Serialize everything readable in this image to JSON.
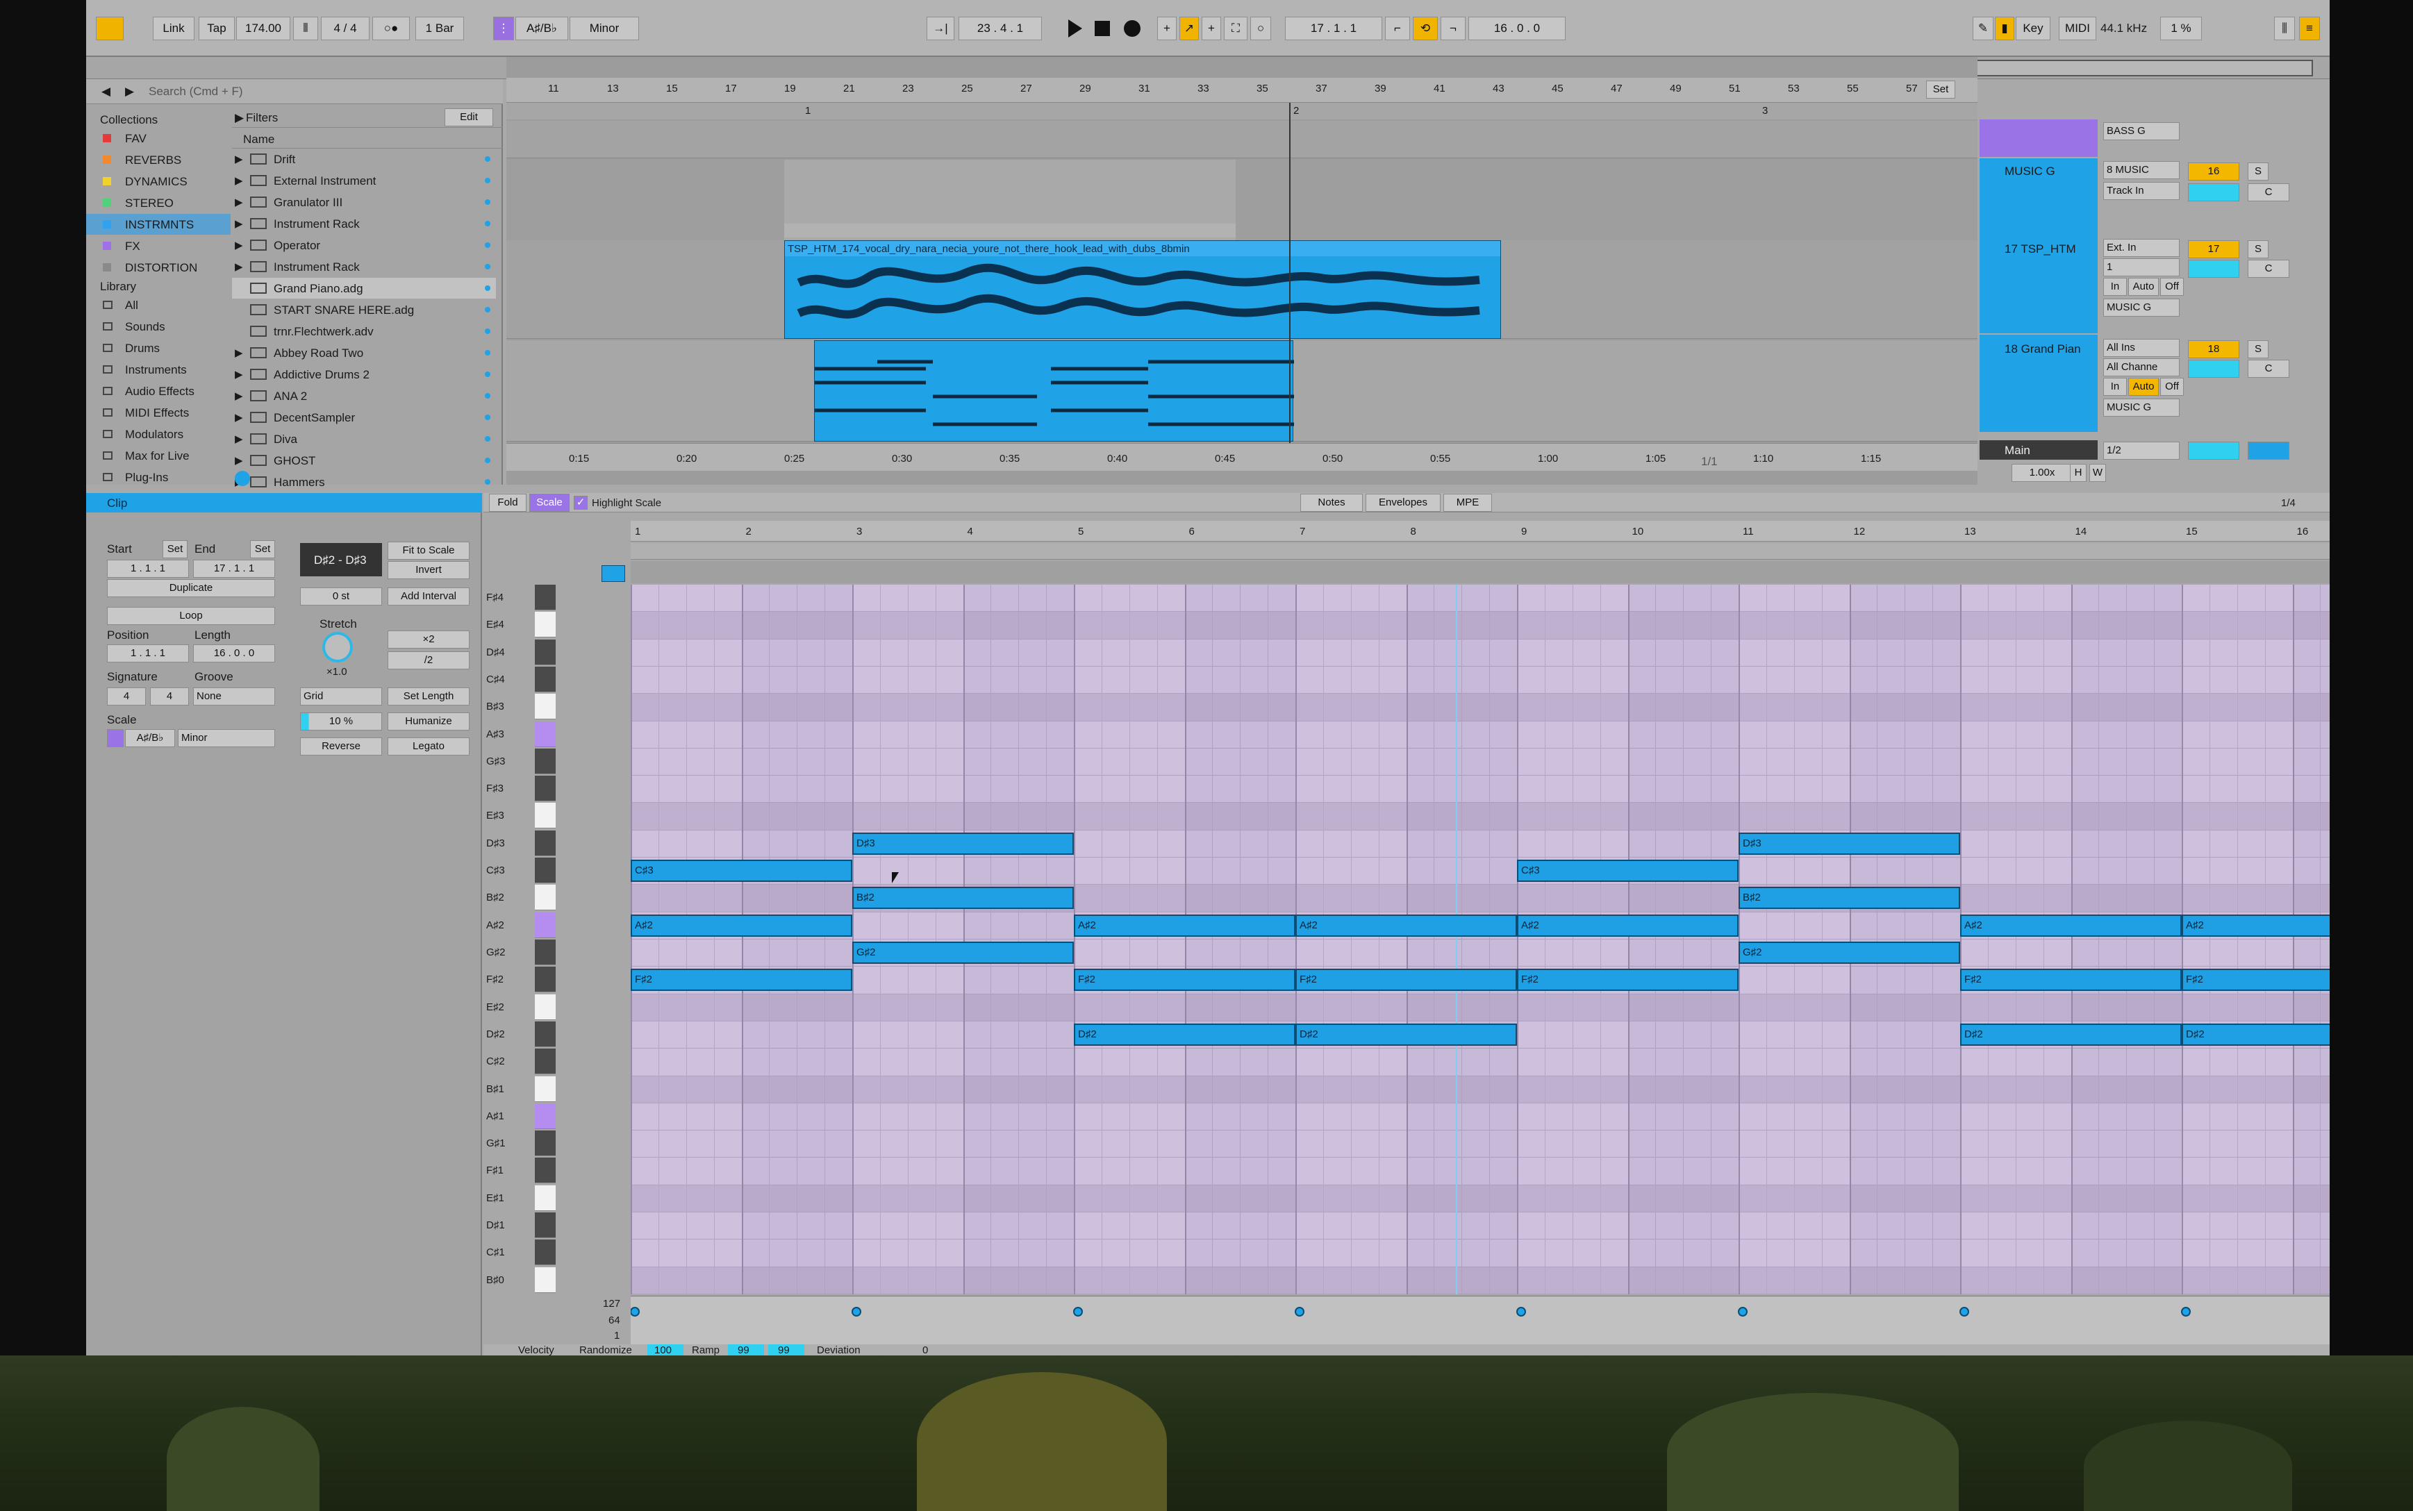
{
  "topbar": {
    "link": "Link",
    "tap": "Tap",
    "tempo": "174.00",
    "signature": "4 / 4",
    "quantize": "1 Bar",
    "scale_key": "A♯/B♭",
    "scale_mode": "Minor",
    "position": "23 . 4 . 1",
    "loop_start": "17 . 1 . 1",
    "loop_length": "16 . 0 . 0",
    "key_label": "Key",
    "midi_label": "MIDI",
    "sample_rate": "44.1 kHz",
    "cpu": "1 %"
  },
  "browser": {
    "search_placeholder": "Search (Cmd + F)",
    "collections_title": "Collections",
    "collections": [
      {
        "label": "FAV",
        "color": "#e23b3b"
      },
      {
        "label": "REVERBS",
        "color": "#f08a2c"
      },
      {
        "label": "DYNAMICS",
        "color": "#f2d12e"
      },
      {
        "label": "STEREO",
        "color": "#4fd27a"
      },
      {
        "label": "INSTRMNTS",
        "color": "#2fa3f0"
      },
      {
        "label": "FX",
        "color": "#a070e8"
      },
      {
        "label": "DISTORTION",
        "color": "#8a8a8a"
      }
    ],
    "library_title": "Library",
    "library": [
      "All",
      "Sounds",
      "Drums",
      "Instruments",
      "Audio Effects",
      "MIDI Effects",
      "Modulators",
      "Max for Live",
      "Plug-Ins"
    ],
    "filters_label": "Filters",
    "edit_label": "Edit",
    "name_header": "Name",
    "items": [
      "Drift",
      "External Instrument",
      "Granulator III",
      "Instrument Rack",
      "Operator",
      "Instrument Rack",
      "Grand Piano.adg",
      "START SNARE HERE.adg",
      "trnr.Flechtwerk.adv",
      "Abbey Road Two",
      "Addictive Drums 2",
      "ANA 2",
      "DecentSampler",
      "Diva",
      "GHOST",
      "Hammers"
    ]
  },
  "arrangement": {
    "bar_numbers": [
      "11",
      "13",
      "15",
      "17",
      "19",
      "21",
      "23",
      "25",
      "27",
      "29",
      "31",
      "33",
      "35",
      "37",
      "39",
      "41",
      "43",
      "45",
      "47",
      "49",
      "51",
      "53",
      "55",
      "57"
    ],
    "locators": [
      "1",
      "2",
      "3"
    ],
    "time_labels": [
      "0:15",
      "0:20",
      "0:25",
      "0:30",
      "0:35",
      "0:40",
      "0:45",
      "0:50",
      "0:55",
      "1:00",
      "1:05",
      "1:10",
      "1:15"
    ],
    "audio_clip_name": "TSP_HTM_174_vocal_dry_nara_necia_youre_not_there_hook_lead_with_dubs_8bmin",
    "page_counter": "1/1",
    "set_label": "Set"
  },
  "mixer": {
    "tracks": [
      {
        "name": "MUSIC G",
        "input": "8 MUSIC",
        "routing": "Track In",
        "number": "16",
        "color": "#1fa2e6"
      },
      {
        "name": "17 TSP_HTM",
        "input": "Ext. In",
        "routing": "1",
        "output": "MUSIC G",
        "number": "17",
        "color": "#1fa2e6"
      },
      {
        "name": "18 Grand Pian",
        "input": "All Ins",
        "routing": "All Channe",
        "output": "MUSIC G",
        "number": "18",
        "color": "#1fa2e6"
      }
    ],
    "bass_group": "BASS G",
    "main_label": "Main",
    "main_routing": "1/2",
    "zoom": "1.00x",
    "s_label": "S",
    "c_label": "C",
    "in_label": "In",
    "auto_label": "Auto",
    "off_label": "Off",
    "h_label": "H",
    "w_label": "W"
  },
  "clip": {
    "title": "Clip",
    "start_label": "Start",
    "end_label": "End",
    "set_label": "Set",
    "start_value": "1 . 1 . 1",
    "end_value": "17 . 1 . 1",
    "duplicate": "Duplicate",
    "loop": "Loop",
    "position_label": "Position",
    "length_label": "Length",
    "position_value": "1 . 1 . 1",
    "length_value": "16 . 0 . 0",
    "signature_label": "Signature",
    "groove_label": "Groove",
    "sig_num": "4",
    "sig_den": "4",
    "groove_value": "None",
    "scale_label": "Scale",
    "scale_key": "A♯/B♭",
    "scale_mode": "Minor",
    "range": "D♯2 - D♯3",
    "fit_to_scale": "Fit to Scale",
    "invert": "Invert",
    "semitones": "0 st",
    "add_interval": "Add Interval",
    "stretch_label": "Stretch",
    "stretch_value": "×1.0",
    "double": "×2",
    "half": "/2",
    "grid": "Grid",
    "set_length": "Set Length",
    "humanize_amount": "10 %",
    "humanize": "Humanize",
    "reverse": "Reverse",
    "legato": "Legato"
  },
  "pianoroll": {
    "fold": "Fold",
    "scale": "Scale",
    "highlight_scale": "Highlight Scale",
    "tabs": [
      "Notes",
      "Envelopes",
      "MPE"
    ],
    "grid_setting": "1/4",
    "bar_numbers": [
      "1",
      "2",
      "3",
      "4",
      "5",
      "6",
      "7",
      "8",
      "9",
      "10",
      "11",
      "12",
      "13",
      "14",
      "15",
      "16"
    ],
    "keys": [
      "F♯4",
      "E♯4",
      "D♯4",
      "C♯4",
      "B♯3",
      "A♯3",
      "G♯3",
      "F♯3",
      "E♯3",
      "D♯3",
      "C♯3",
      "B♯2",
      "A♯2",
      "G♯2",
      "F♯2",
      "E♯2",
      "D♯2",
      "C♯2",
      "B♯1",
      "A♯1",
      "G♯1",
      "F♯1",
      "E♯1",
      "D♯1",
      "C♯1",
      "B♯0"
    ],
    "notes": [
      {
        "pitch": "C♯3",
        "start": 1,
        "length": 2,
        "label": "C♯3"
      },
      {
        "pitch": "A♯2",
        "start": 1,
        "length": 2,
        "label": "A♯2"
      },
      {
        "pitch": "F♯2",
        "start": 1,
        "length": 2,
        "label": "F♯2"
      },
      {
        "pitch": "D♯3",
        "start": 3,
        "length": 2,
        "label": "D♯3"
      },
      {
        "pitch": "B♯2",
        "start": 3,
        "length": 2,
        "label": "B♯2"
      },
      {
        "pitch": "G♯2",
        "start": 3,
        "length": 2,
        "label": "G♯2"
      },
      {
        "pitch": "A♯2",
        "start": 5,
        "length": 2,
        "label": "A♯2"
      },
      {
        "pitch": "F♯2",
        "start": 5,
        "length": 2,
        "label": "F♯2"
      },
      {
        "pitch": "D♯2",
        "start": 5,
        "length": 2,
        "label": "D♯2"
      },
      {
        "pitch": "A♯2",
        "start": 7,
        "length": 2,
        "label": "A♯2"
      },
      {
        "pitch": "F♯2",
        "start": 7,
        "length": 2,
        "label": "F♯2"
      },
      {
        "pitch": "D♯2",
        "start": 7,
        "length": 2,
        "label": "D♯2"
      },
      {
        "pitch": "C♯3",
        "start": 9,
        "length": 2,
        "label": "C♯3"
      },
      {
        "pitch": "A♯2",
        "start": 9,
        "length": 2,
        "label": "A♯2"
      },
      {
        "pitch": "F♯2",
        "start": 9,
        "length": 2,
        "label": "F♯2"
      },
      {
        "pitch": "D♯3",
        "start": 11,
        "length": 2,
        "label": "D♯3"
      },
      {
        "pitch": "B♯2",
        "start": 11,
        "length": 2,
        "label": "B♯2"
      },
      {
        "pitch": "G♯2",
        "start": 11,
        "length": 2,
        "label": "G♯2"
      },
      {
        "pitch": "A♯2",
        "start": 13,
        "length": 2,
        "label": "A♯2"
      },
      {
        "pitch": "F♯2",
        "start": 13,
        "length": 2,
        "label": "F♯2"
      },
      {
        "pitch": "D♯2",
        "start": 13,
        "length": 2,
        "label": "D♯2"
      },
      {
        "pitch": "A♯2",
        "start": 15,
        "length": 2,
        "label": "A♯2"
      },
      {
        "pitch": "F♯2",
        "start": 15,
        "length": 2,
        "label": "F♯2"
      },
      {
        "pitch": "D♯2",
        "start": 15,
        "length": 2,
        "label": "D♯2"
      }
    ],
    "velocity_scale": [
      "127",
      "64",
      "1"
    ],
    "velocity_label": "Velocity",
    "randomize": "Randomize",
    "velocity_value": "100",
    "ramp_label": "Ramp",
    "ramp_a": "99",
    "ramp_b": "99",
    "deviation_label": "Deviation",
    "deviation_value": "0"
  }
}
